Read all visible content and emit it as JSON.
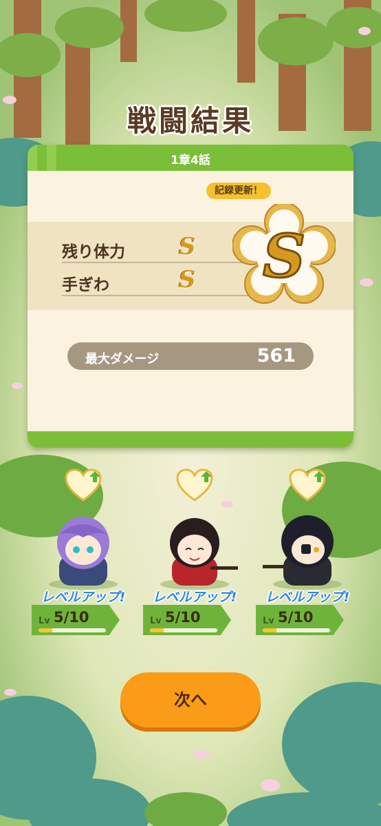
{
  "title": "戦闘結果",
  "stage": "1章4話",
  "ranks": [
    {
      "label": "残り体力",
      "grade": "S"
    },
    {
      "label": "手ぎわ",
      "grade": "S"
    }
  ],
  "overall_grade": "S",
  "record_badge": "記録更新！",
  "max_damage": {
    "label": "最大ダメージ",
    "value": "561"
  },
  "characters": [
    {
      "level_up": "レベルアップ!",
      "lv_prefix": "Lv",
      "level": "5/10",
      "xp_fraction": 0.2
    },
    {
      "level_up": "レベルアップ!",
      "lv_prefix": "Lv",
      "level": "5/10",
      "xp_fraction": 0.2
    },
    {
      "level_up": "レベルアップ!",
      "lv_prefix": "Lv",
      "level": "5/10",
      "xp_fraction": 0.2
    }
  ],
  "next_button": "次へ",
  "colors": {
    "accent_green": "#7bbf39",
    "gold": "#d39a1f",
    "button_orange": "#fa9c18"
  }
}
